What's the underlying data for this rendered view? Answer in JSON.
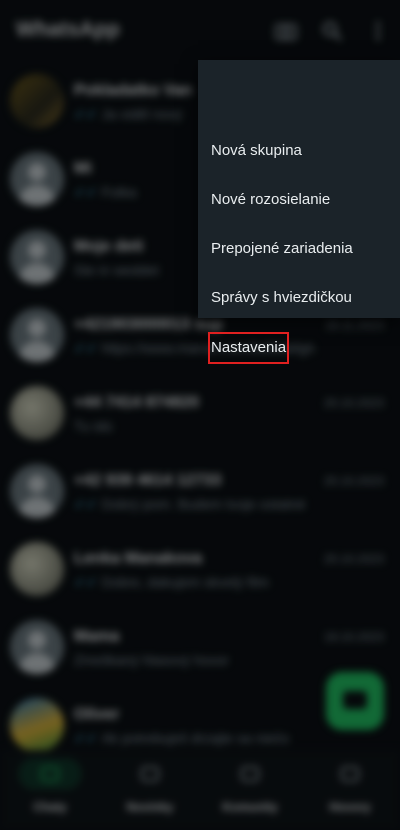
{
  "app": {
    "title": "WhatsApp"
  },
  "chats": [
    {
      "name": "Pokladatko Van",
      "preview": "Ja viděl nový",
      "time": "",
      "tick": true,
      "avatar": "photo1"
    },
    {
      "name": "Mi",
      "preview": "Fotka",
      "time": "",
      "tick": true,
      "avatar": "default"
    },
    {
      "name": "Moje deti",
      "preview": "Ste in weddet",
      "time": "",
      "tick": false,
      "avatar": "default"
    },
    {
      "name": "+421903000013 sup",
      "preview": "https://www.marvel.com/bdfdsbfgh",
      "time": "18.11.2023",
      "tick": true,
      "avatar": "default"
    },
    {
      "name": "+44 7414 874820",
      "preview": "Tu idú",
      "time": "20.10.2023",
      "tick": false,
      "avatar": "photo2"
    },
    {
      "name": "+42 939 4614 12733",
      "preview": "Dobrý pom. Budem tvoje ostatné",
      "time": "20.10.2023",
      "tick": true,
      "avatar": "default"
    },
    {
      "name": "Lenka Manakova",
      "preview": "Dobre, dakujem skvelý film",
      "time": "20.10.2023",
      "tick": true,
      "avatar": "photo2"
    },
    {
      "name": "Mama",
      "preview": "Zmeškaný hlasový hovor",
      "time": "19.10.2023",
      "tick": false,
      "avatar": "default"
    },
    {
      "name": "Oliver",
      "preview": "Ak potrebuješ drzajte sa niečo",
      "time": "",
      "tick": true,
      "avatar": "photo3"
    }
  ],
  "nav": [
    {
      "label": "Chaty",
      "active": true
    },
    {
      "label": "Novinky",
      "active": false
    },
    {
      "label": "Komunity",
      "active": false
    },
    {
      "label": "Hovory",
      "active": false
    }
  ],
  "menu": {
    "items": [
      {
        "label": "Nová skupina"
      },
      {
        "label": "Nové rozosielanie"
      },
      {
        "label": "Prepojené zariadenia"
      },
      {
        "label": "Správy s hviezdičkou"
      },
      {
        "label": "Nastavenia"
      }
    ]
  },
  "colors": {
    "accent": "#21c063",
    "highlight": "#e02020",
    "menu_bg": "#1b2329"
  }
}
